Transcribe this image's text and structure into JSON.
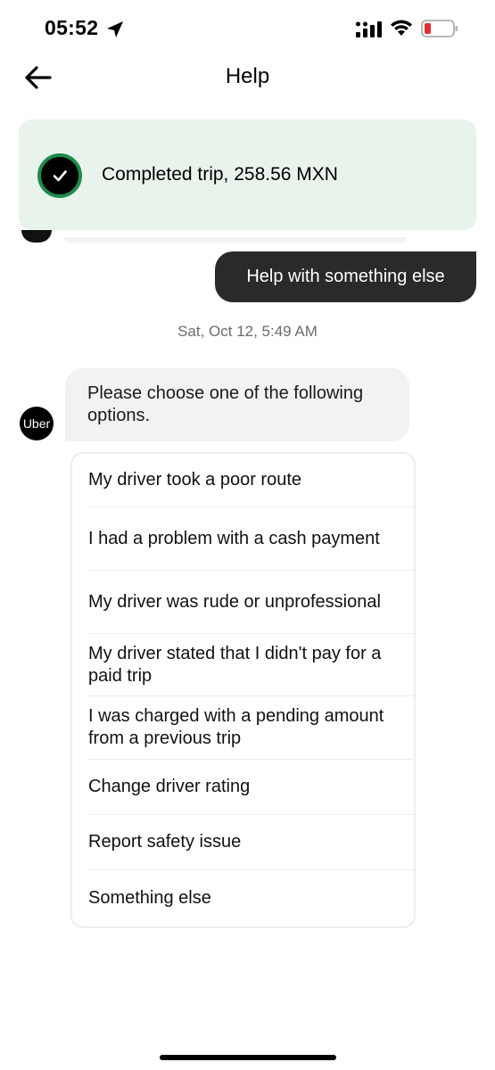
{
  "status_bar": {
    "time": "05:52",
    "icons": [
      "location-arrow-icon",
      "signal-icon",
      "wifi-icon",
      "battery-low-icon"
    ],
    "battery_color": "#e0302f"
  },
  "header": {
    "title": "Help",
    "back_icon": "back-arrow-icon"
  },
  "trip_card": {
    "text": "Completed trip, 258.56 MXN",
    "icon": "check-circle-icon",
    "background": "#e8f3ec",
    "accent": "#1f8a4c"
  },
  "chat": {
    "user_message": "Help with something else",
    "timestamp": "Sat, Oct 12, 5:49 AM",
    "bot_avatar_label": "Uber",
    "bot_message": "Please choose one of the following options."
  },
  "options": [
    {
      "label": "My driver took a poor route"
    },
    {
      "label": "I had a problem with a cash payment"
    },
    {
      "label": "My driver was rude or unprofessional"
    },
    {
      "label": "My driver stated that I didn't pay for a paid trip"
    },
    {
      "label": "I was charged with a pending amount from a previous trip"
    },
    {
      "label": "Change driver rating"
    },
    {
      "label": "Report safety issue"
    },
    {
      "label": "Something else"
    }
  ]
}
